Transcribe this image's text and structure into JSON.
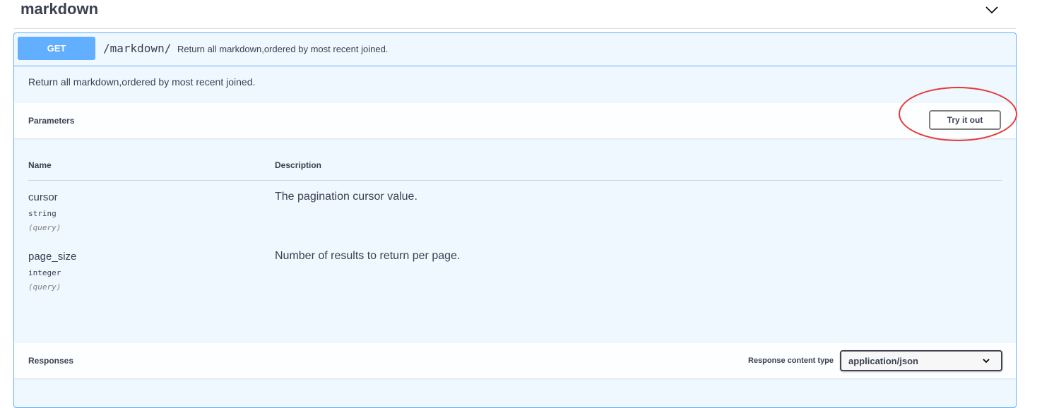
{
  "tag": {
    "title": "markdown",
    "toggle_icon": "chevron-down-icon"
  },
  "operation": {
    "method": "GET",
    "path": "/markdown/",
    "summary": "Return all markdown,ordered by most recent joined.",
    "description": "Return all markdown,ordered by most recent joined.",
    "method_color": "#61affe"
  },
  "parameters": {
    "title": "Parameters",
    "try_button": "Try it out",
    "headers": {
      "name": "Name",
      "description": "Description"
    },
    "rows": [
      {
        "name": "cursor",
        "type": "string",
        "in": "(query)",
        "description": "The pagination cursor value."
      },
      {
        "name": "page_size",
        "type": "integer",
        "in": "(query)",
        "description": "Number of results to return per page."
      }
    ]
  },
  "responses": {
    "title": "Responses",
    "content_type_label": "Response content type",
    "content_type_value": "application/json"
  },
  "annotation": {
    "highlight_color": "#e53935"
  }
}
